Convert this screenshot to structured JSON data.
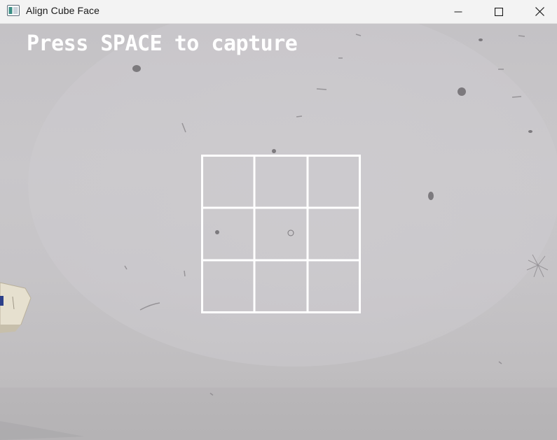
{
  "window": {
    "title": "Align Cube Face",
    "app_icon": "opencv-window-icon",
    "controls": [
      "minimize-icon",
      "maximize-icon",
      "close-icon"
    ]
  },
  "camera_view": {
    "instruction": "Press SPACE to capture",
    "overlay_color": "#ffffff",
    "guide": {
      "rows": 3,
      "cols": 3,
      "line_color": "#ffffff"
    }
  }
}
